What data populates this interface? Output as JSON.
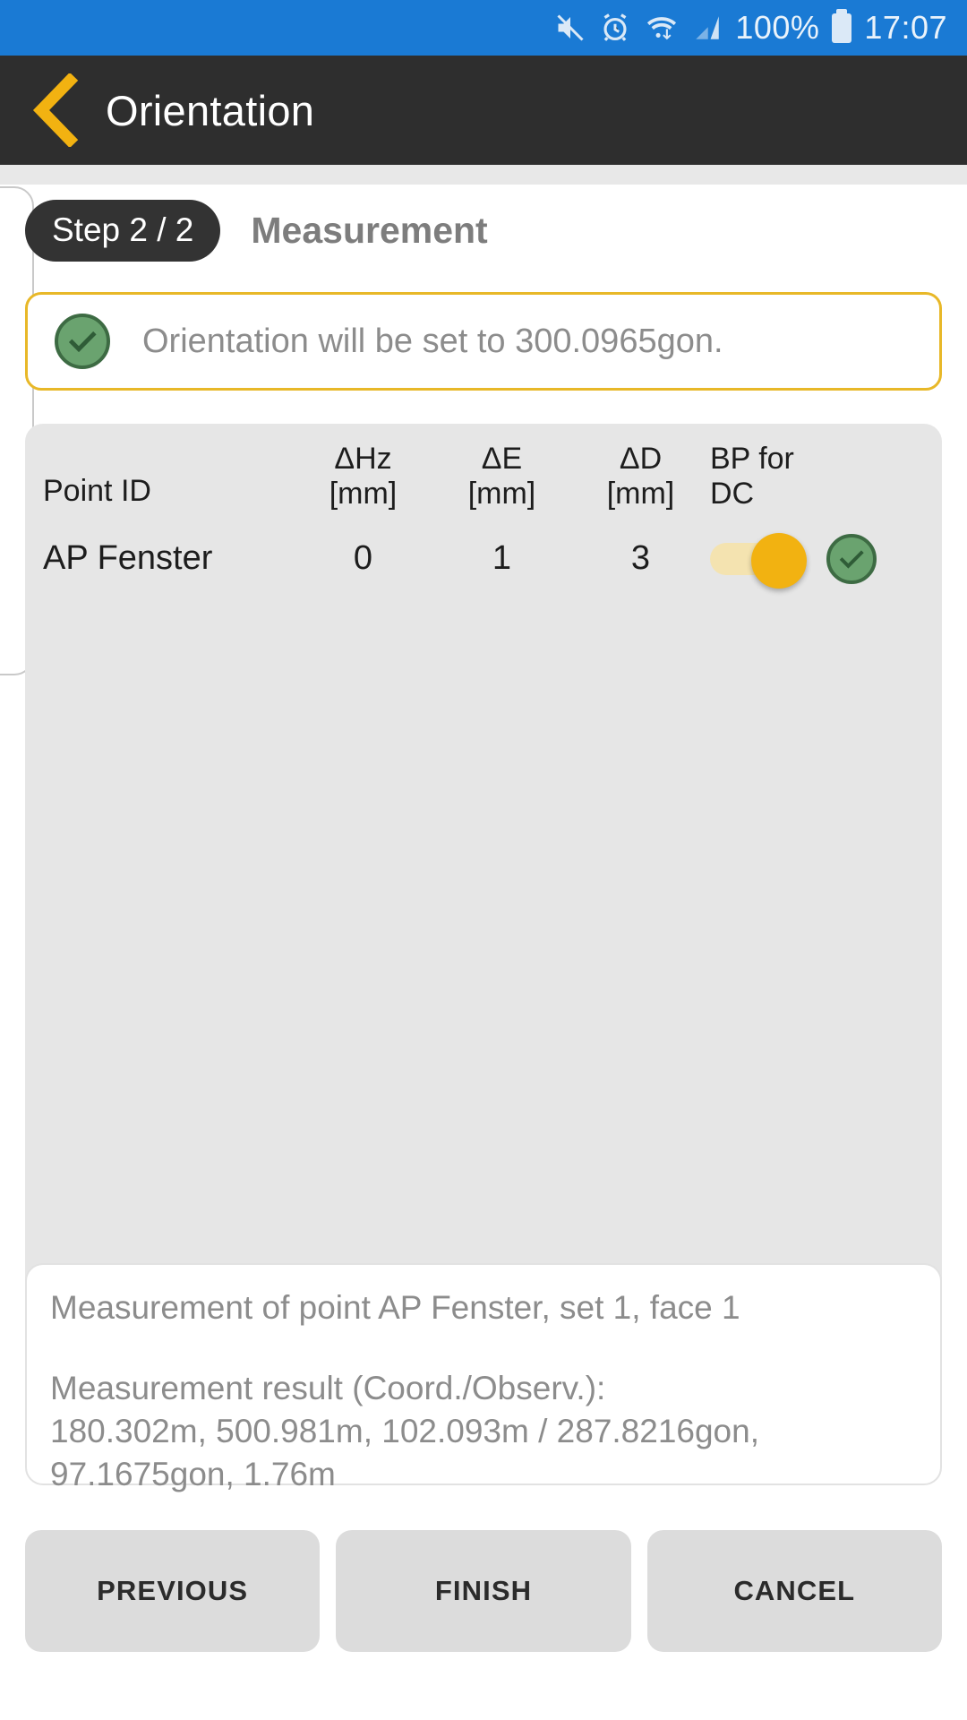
{
  "statusbar": {
    "icons": [
      "mute-icon",
      "alarm-icon",
      "wifi-icon",
      "signal-icon"
    ],
    "battery_percent": "100%",
    "time": "17:07",
    "bg_color": "#1a7ad4"
  },
  "appbar": {
    "back_icon": "chevron-left-icon",
    "title": "Orientation",
    "bg_color": "#2e2e2e",
    "accent_color": "#f2b211"
  },
  "step": {
    "chip": "Step 2 / 2",
    "label": "Measurement"
  },
  "notice": {
    "icon": "check-circle-icon",
    "text": "Orientation will be set to 300.0965gon.",
    "border_color": "#e8b828"
  },
  "table": {
    "headers": {
      "point_id": "Point ID",
      "hz_top": "ΔHz",
      "hz_bottom": "[mm]",
      "e_top": "ΔE",
      "e_bottom": "[mm]",
      "d_top": "ΔD",
      "d_bottom": "[mm]",
      "bp_top": "BP for",
      "bp_bottom": "DC"
    },
    "rows": [
      {
        "point_id": "AP Fenster",
        "d_hz": "0",
        "d_e": "1",
        "d_d": "3",
        "bp_toggle_on": true,
        "status_icon": "check-circle-icon"
      }
    ],
    "bg_color": "#e6e6e6"
  },
  "info": {
    "line1": "Measurement of point AP Fenster, set 1, face 1",
    "line2": "Measurement result (Coord./Observ.):",
    "line3": "180.302m, 500.981m, 102.093m / 287.8216gon,",
    "line4": "97.1675gon, 1.76m"
  },
  "buttons": {
    "previous": "PREVIOUS",
    "finish": "FINISH",
    "cancel": "CANCEL"
  }
}
